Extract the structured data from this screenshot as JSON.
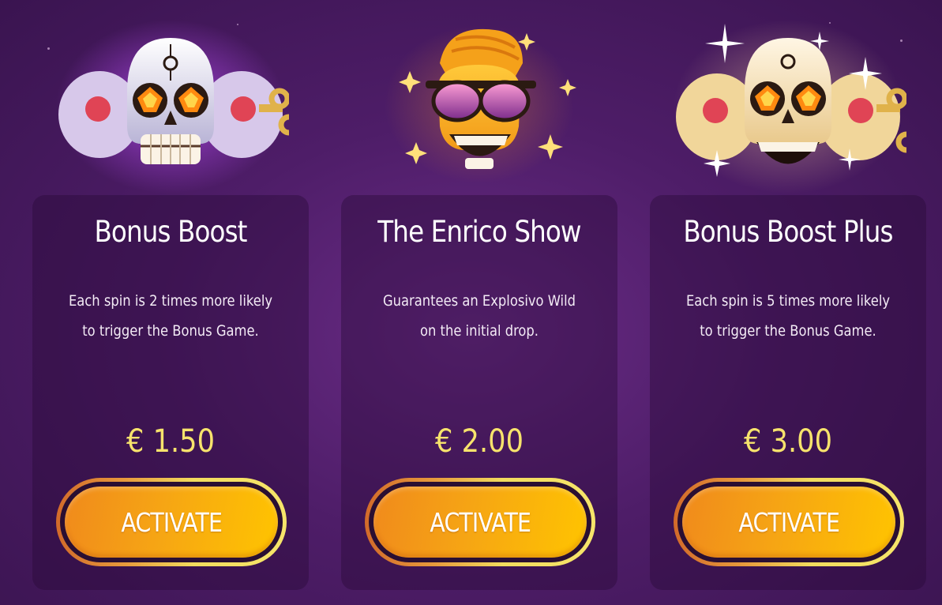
{
  "currency_symbol": "€",
  "cards": [
    {
      "art_icon": "bonus-boost-skull-icon",
      "title": "Bonus Boost",
      "description": "Each spin is 2 times more likely to trigger the Bonus Game.",
      "price": "€ 1.50",
      "button_label": "ACTIVATE"
    },
    {
      "art_icon": "enrico-skull-sunglasses-icon",
      "title": "The Enrico Show",
      "description": "Guarantees an Explosivo Wild on the initial drop.",
      "price": "€ 2.00",
      "button_label": "ACTIVATE"
    },
    {
      "art_icon": "bonus-boost-plus-skull-icon",
      "title": "Bonus Boost Plus",
      "description": "Each spin is 5 times more likely to trigger the Bonus Game.",
      "price": "€ 3.00",
      "button_label": "ACTIVATE"
    }
  ],
  "colors": {
    "background": "#4e1d68",
    "price": "#f7e36c",
    "button_fill": "#f6a514",
    "button_ring": "#f2dc5e"
  }
}
